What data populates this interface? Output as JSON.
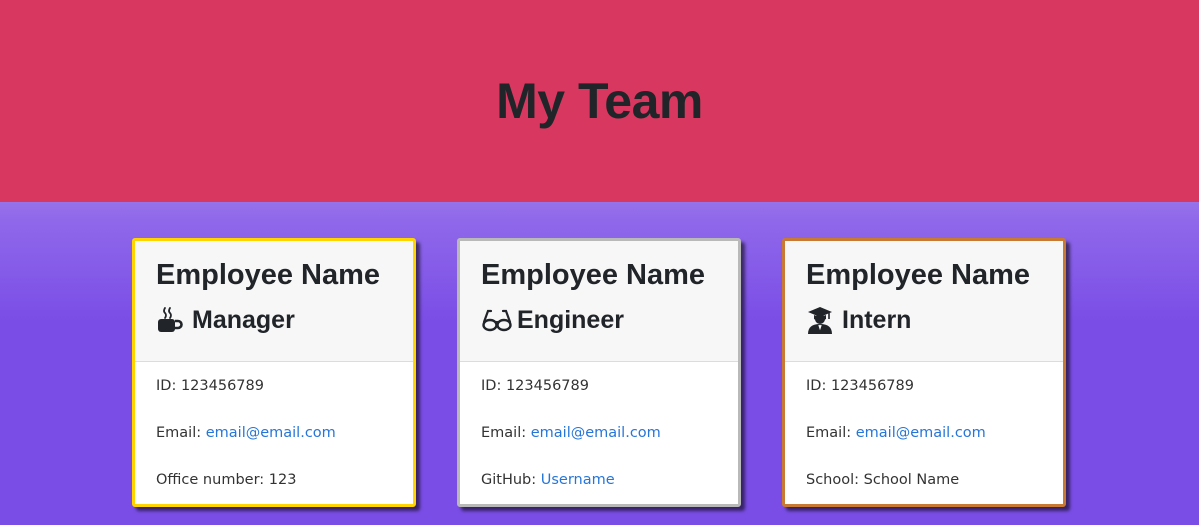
{
  "header": {
    "title": "My Team"
  },
  "cards": [
    {
      "name": "Employee Name",
      "role": "Manager",
      "icon": "coffee-mug-icon",
      "id_label": "ID:",
      "id_value": "123456789",
      "email_label": "Email:",
      "email_value": "email@email.com",
      "extra_label": "Office number:",
      "extra_value": "123",
      "border_color": "#ffd400"
    },
    {
      "name": "Employee Name",
      "role": "Engineer",
      "icon": "glasses-icon",
      "id_label": "ID:",
      "id_value": "123456789",
      "email_label": "Email:",
      "email_value": "email@email.com",
      "extra_label": "GitHub:",
      "extra_value": "Username",
      "border_color": "#b9b9b9"
    },
    {
      "name": "Employee Name",
      "role": "Intern",
      "icon": "graduate-icon",
      "id_label": "ID:",
      "id_value": "123456789",
      "email_label": "Email:",
      "email_value": "email@email.com",
      "extra_label": "School:",
      "extra_value": "School Name",
      "border_color": "#c87a35"
    }
  ],
  "colors": {
    "header_bg": "#d8385f",
    "link": "#2676d8",
    "gradient_top": "#cbb9f3",
    "gradient_bottom": "#7a4de6"
  }
}
